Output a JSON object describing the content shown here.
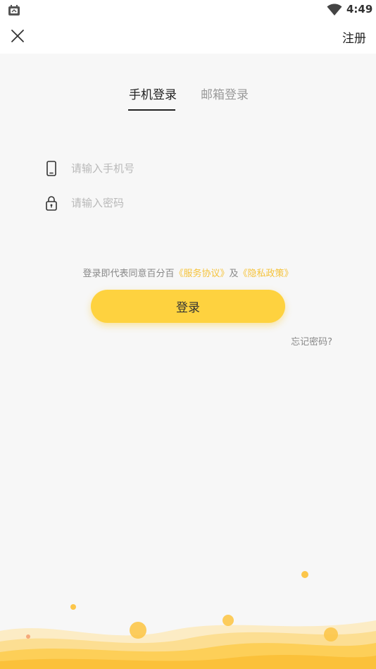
{
  "status_bar": {
    "time": "4:49",
    "icons": [
      "android-debug-icon",
      "wifi-icon"
    ]
  },
  "header": {
    "close_icon": "close-icon",
    "register_label": "注册"
  },
  "tabs": [
    {
      "label": "手机登录",
      "active": true
    },
    {
      "label": "邮箱登录",
      "active": false
    }
  ],
  "form": {
    "phone_placeholder": "请输入手机号",
    "phone_icon": "phone-icon",
    "password_placeholder": "请输入密码",
    "password_icon": "lock-icon"
  },
  "agreement": {
    "prefix": "登录即代表同意百分百",
    "service_link": "《服务协议》",
    "conjunction": "及",
    "privacy_link": "《隐私政策》"
  },
  "login_button_label": "登录",
  "forgot_password_label": "忘记密码?",
  "colors": {
    "accent": "#fed23f",
    "link": "#f5c33b",
    "background": "#f7f7f7"
  }
}
